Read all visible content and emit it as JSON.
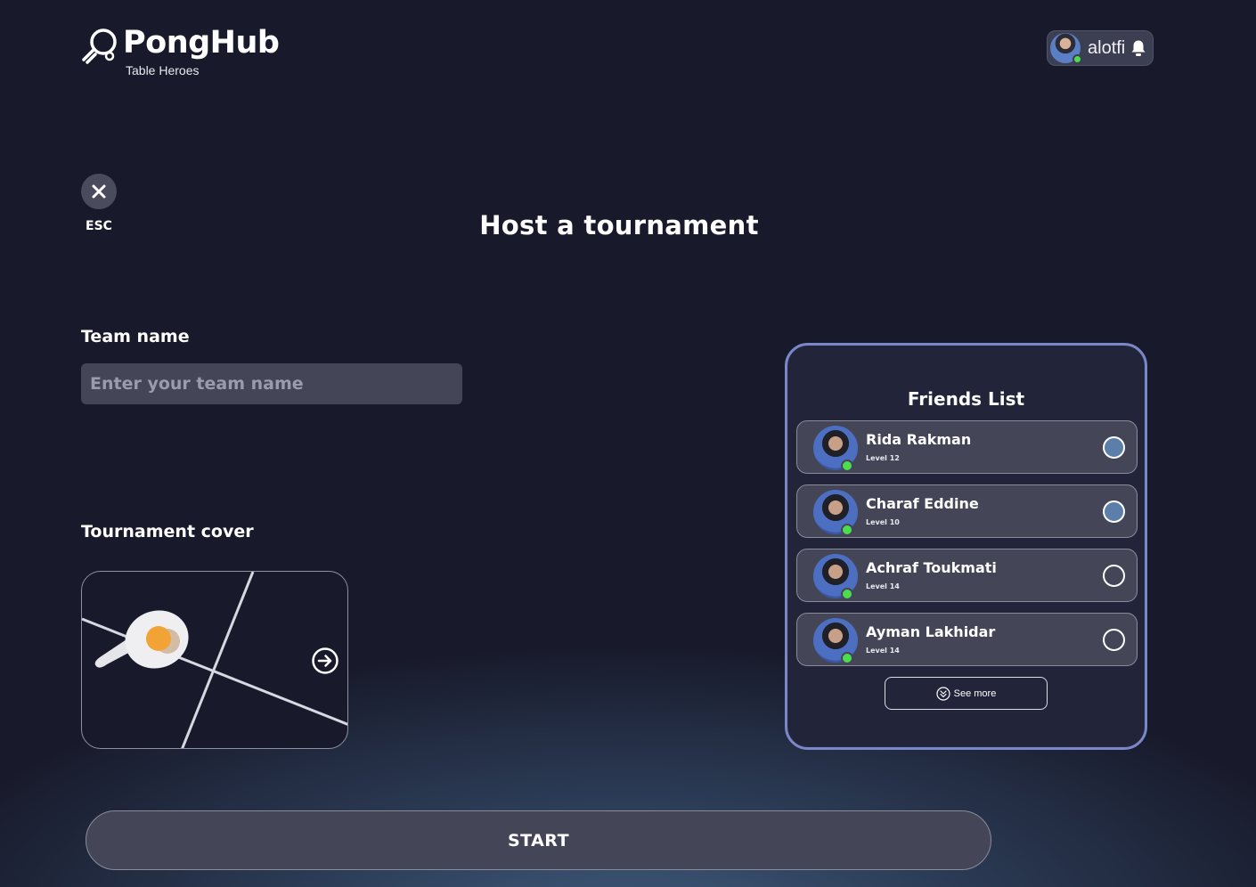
{
  "brand": {
    "name": "PongHub",
    "tagline": "Table Heroes"
  },
  "user": {
    "username": "alotfi",
    "status": "online"
  },
  "esc": {
    "label": "ESC"
  },
  "page": {
    "title": "Host a tournament"
  },
  "team": {
    "label": "Team name",
    "placeholder": "Enter your team name",
    "value": ""
  },
  "cover": {
    "label": "Tournament cover"
  },
  "friends": {
    "title": "Friends List",
    "items": [
      {
        "name": "Rida Rakman",
        "level": "Level 12",
        "selected": true
      },
      {
        "name": "Charaf Eddine",
        "level": "Level 10",
        "selected": true
      },
      {
        "name": "Achraf Toukmati",
        "level": "Level 14",
        "selected": false
      },
      {
        "name": "Ayman Lakhidar",
        "level": "Level 14",
        "selected": false
      }
    ],
    "see_more": "See more"
  },
  "actions": {
    "start": "START"
  },
  "colors": {
    "background": "#181a2b",
    "panel_border": "#7a88c9",
    "online": "#4cde4f",
    "row_bg": "#444657",
    "selected_radio": "#5b7fa8"
  }
}
